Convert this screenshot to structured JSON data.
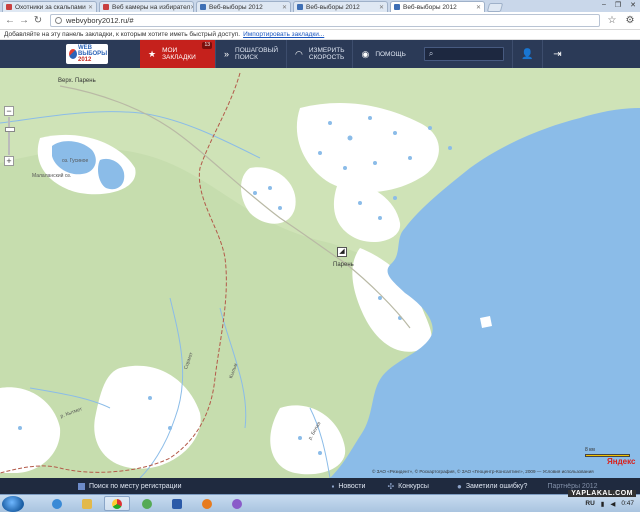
{
  "browser": {
    "tabs": [
      {
        "label": "Охотники за скальпами",
        "favicon_color": "#c94040",
        "active": false
      },
      {
        "label": "Веб камеры на избирател",
        "favicon_color": "#c94040",
        "active": false
      },
      {
        "label": "Веб-выборы 2012",
        "favicon_color": "#3e6fb5",
        "active": false
      },
      {
        "label": "Веб-выборы 2012",
        "favicon_color": "#3e6fb5",
        "active": false
      },
      {
        "label": "Веб-выборы 2012",
        "favicon_color": "#3e6fb5",
        "active": true
      }
    ],
    "url": "webvybory2012.ru/#",
    "bookmarks_prompt": "Добавляйте на эту панель закладки, к которым хотите иметь быстрый доступ.",
    "bookmarks_link": "Импортировать закладки..."
  },
  "site": {
    "logo_line1": "WEB",
    "logo_line2": "ВЫБОРЫ",
    "logo_line3": "2012",
    "nav": {
      "bookmarks_label_1": "МОИ",
      "bookmarks_label_2": "ЗАКЛАДКИ",
      "bookmarks_count": "13",
      "step_search_1": "ПОШАГОВЫЙ",
      "step_search_2": "ПОИСК",
      "speed_1": "ИЗМЕРИТЬ",
      "speed_2": "СКОРОСТЬ",
      "help": "ПОМОЩЬ"
    },
    "search_placeholder": ""
  },
  "map": {
    "labels": {
      "top_village": "Верх. Парень",
      "lake_left": "Малаланский оз.",
      "lake_right": "оз. Гусиное",
      "center_village": "Парень",
      "river1": "р. Кытмет",
      "river2": "Сормот",
      "river3": "Кыльм",
      "river4": "р. Белая"
    },
    "scale_label": "8 км",
    "provider": "Яндекс",
    "copyright": "© ЗАО «Резидент», © Роскартография, © ЗАО «Геоцентр-Консалтинг», 2009 — Условия использования"
  },
  "footer": {
    "register_search": "Поиск по месту регистрации",
    "news": "Новости",
    "contests": "Конкурсы",
    "report_error": "Заметили ошибку?",
    "partners": "Партнёры 2012"
  },
  "taskbar": {
    "lang": "RU",
    "time": "0:47"
  },
  "watermark": "YAPLAKAL.COM",
  "colors": {
    "header_bg": "#2b3a57",
    "accent_red": "#c5211c",
    "land": "#cfe3b7",
    "water": "#8bbce8"
  }
}
